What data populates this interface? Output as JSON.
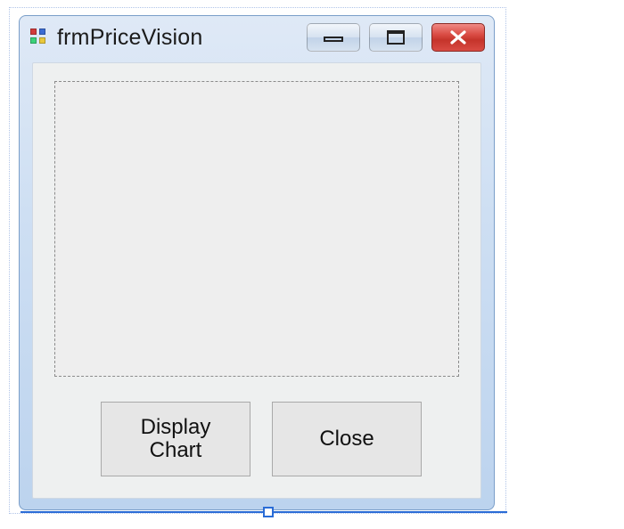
{
  "window": {
    "title": "frmPriceVision"
  },
  "buttons": {
    "display_chart": "Display\nChart",
    "close": "Close"
  }
}
